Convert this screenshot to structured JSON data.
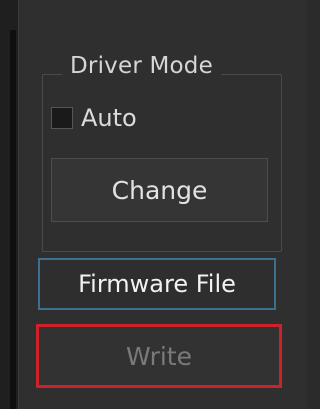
{
  "driver_mode": {
    "title": "Driver Mode",
    "auto_label": "Auto",
    "auto_checked": false,
    "change_label": "Change"
  },
  "firmware": {
    "file_label": "Firmware File",
    "write_label": "Write",
    "write_enabled": false
  },
  "colors": {
    "panel_bg": "#2f2f2f",
    "highlight_border": "#d0202a",
    "focus_border": "#3e6f8d",
    "disabled_text": "#7a7a7a"
  }
}
